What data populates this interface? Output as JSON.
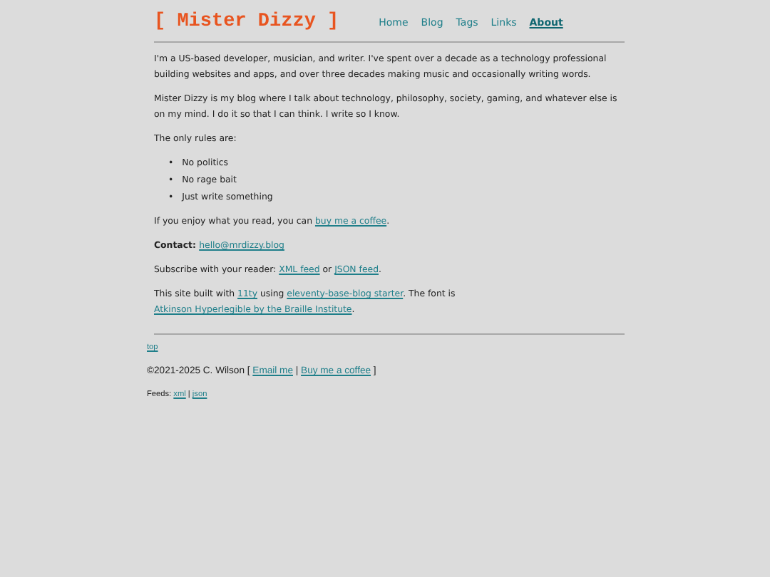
{
  "header": {
    "title": "[ Mister Dizzy ]",
    "nav": [
      {
        "label": "Home",
        "selected": false
      },
      {
        "label": "Blog",
        "selected": false
      },
      {
        "label": "Tags",
        "selected": false
      },
      {
        "label": "Links",
        "selected": false
      },
      {
        "label": "About",
        "selected": true
      }
    ]
  },
  "content": [
    {
      "kind": "paragraph",
      "parts": [
        {
          "kind": "text",
          "text": "I'm a US-based developer, musician, and writer. I've spent over a decade as a technology professional building websites and apps, and over three decades making music and occasionally writing words."
        }
      ]
    },
    {
      "kind": "paragraph",
      "parts": [
        {
          "kind": "text",
          "text": "Mister Dizzy is my blog where I talk about technology, philosophy, society, gaming, and whatever else is on my mind. I do it so that I can think. I write so I know."
        }
      ]
    },
    {
      "kind": "paragraph",
      "parts": [
        {
          "kind": "text",
          "text": "The only rules are:"
        }
      ]
    },
    {
      "kind": "list",
      "items": [
        {
          "marker": "•",
          "text": "No politics"
        },
        {
          "marker": "•",
          "text": "No rage bait"
        },
        {
          "marker": "•",
          "text": "Just write something"
        }
      ]
    },
    {
      "kind": "paragraph",
      "parts": [
        {
          "kind": "text",
          "text": "If you enjoy what you read, you can "
        },
        {
          "kind": "link",
          "text": "buy me a coffee"
        },
        {
          "kind": "text",
          "text": "."
        }
      ]
    },
    {
      "kind": "paragraph",
      "parts": [
        {
          "kind": "bold",
          "text": "Contact:"
        },
        {
          "kind": "link",
          "text": "hello@mrdizzy.blog"
        }
      ]
    },
    {
      "kind": "paragraph",
      "parts": [
        {
          "kind": "text",
          "text": "Subscribe with your reader: "
        },
        {
          "kind": "link",
          "text": "XML feed"
        },
        {
          "kind": "text",
          "text": " or "
        },
        {
          "kind": "link",
          "text": "JSON feed"
        },
        {
          "kind": "text",
          "text": "."
        }
      ]
    },
    {
      "kind": "paragraph",
      "parts": [
        {
          "kind": "text",
          "text": "This site built with "
        },
        {
          "kind": "link",
          "text": "11ty"
        },
        {
          "kind": "text",
          "text": " using "
        },
        {
          "kind": "link",
          "text": "eleventy-base-blog starter"
        },
        {
          "kind": "text",
          "text": ". The font is "
        },
        {
          "kind": "link",
          "text": "Atkinson Hyperlegible by the Braille Institute"
        },
        {
          "kind": "text",
          "text": "."
        }
      ]
    }
  ],
  "footer": [
    {
      "parts": [
        {
          "kind": "link",
          "text": "top"
        }
      ]
    },
    {
      "parts": [
        {
          "kind": "text",
          "text": "©2021-2025 C. Wilson [ "
        },
        {
          "kind": "link",
          "text": "Email me"
        },
        {
          "kind": "text",
          "text": " | "
        },
        {
          "kind": "link",
          "text": "Buy me a coffee"
        },
        {
          "kind": "text",
          "text": " ]"
        }
      ]
    },
    {
      "parts": [
        {
          "kind": "text",
          "text": "Feeds: "
        },
        {
          "kind": "link",
          "text": "xml"
        },
        {
          "kind": "text",
          "text": " | "
        },
        {
          "kind": "link",
          "text": "json"
        }
      ]
    }
  ]
}
